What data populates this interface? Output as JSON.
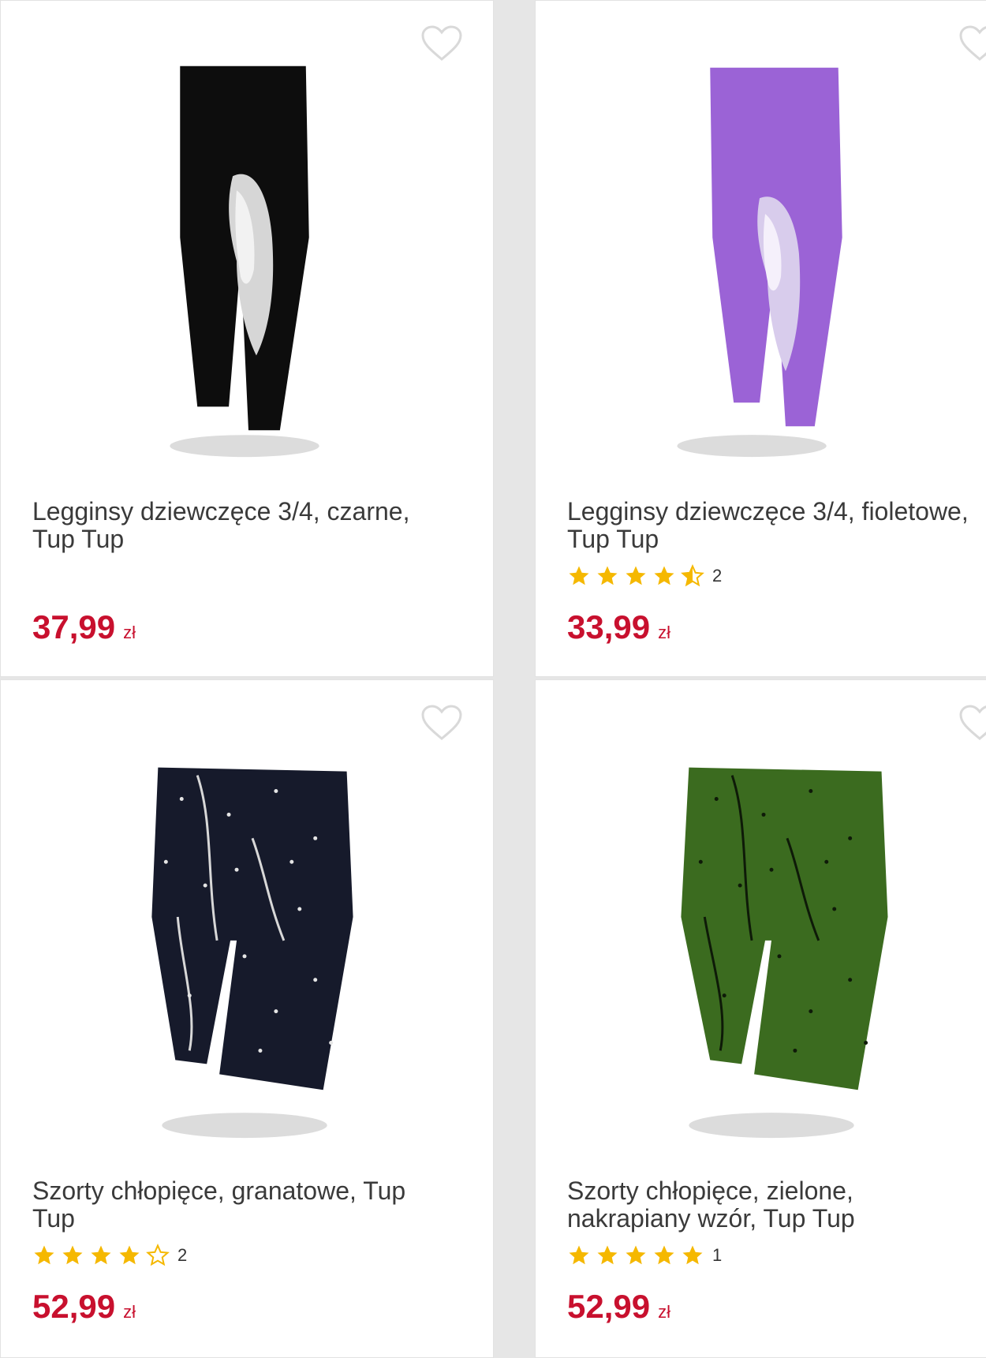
{
  "colors": {
    "price": "#c8102e",
    "star": "#f5b800",
    "border": "#e2e2e2"
  },
  "products": [
    {
      "title": "Legginsy dziewczęce 3/4, czarne, Tup Tup",
      "price": "37,99",
      "currency": "zł",
      "rating_stars": null,
      "rating_count": null,
      "image": "black-leggings-horse-print"
    },
    {
      "title": "Legginsy dziewczęce 3/4, fioletowe, Tup Tup",
      "price": "33,99",
      "currency": "zł",
      "rating_stars": 4.5,
      "rating_count": "2",
      "image": "purple-leggings-horse-print"
    },
    {
      "title": "Szorty chłopięce, granatowe, Tup Tup",
      "price": "52,99",
      "currency": "zł",
      "rating_stars": 4,
      "rating_count": "2",
      "image": "navy-shorts-splatter"
    },
    {
      "title": "Szorty chłopięce, zielone, nakrapiany wzór, Tup Tup",
      "price": "52,99",
      "currency": "zł",
      "rating_stars": 5,
      "rating_count": "1",
      "image": "green-shorts-splatter"
    }
  ]
}
